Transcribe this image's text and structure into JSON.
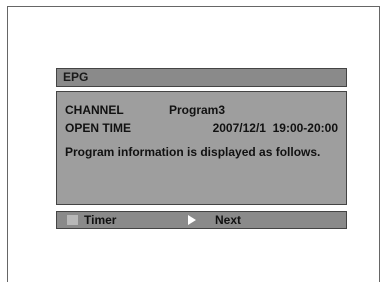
{
  "epg": {
    "title": "EPG",
    "channel_label": "CHANNEL",
    "channel_value": "Program3",
    "open_time_label": "OPEN TIME",
    "open_time_value": "2007/12/1  19:00-20:00",
    "info_text": "Program information is displayed as follows."
  },
  "footer": {
    "timer_label": "Timer",
    "next_label": "Next",
    "timer_icon": "square-button-icon",
    "next_icon": "play-arrow-icon"
  }
}
